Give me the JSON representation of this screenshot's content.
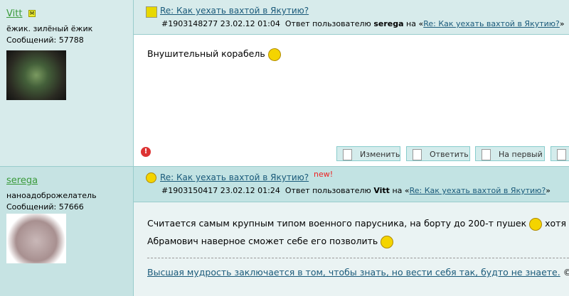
{
  "posts": [
    {
      "author": "Vitt",
      "moderator_badge": "М",
      "status": "ёжик. зилёный ёжик",
      "count": "Сообщений: 57788",
      "title": "Re: Как уехать вахтой в Якутию?",
      "id_date": "#1903148277 23.02.12 01:04",
      "reply_prefix": "Ответ пользователю",
      "reply_user": "serega",
      "reply_on": "на «",
      "reply_link": "Re: Как уехать вахтой в Якутию?",
      "reply_close": "»",
      "text": "Внушительный корабель",
      "icon": "book-icon",
      "buttons": [
        "Изменить",
        "Ответить",
        "На первый"
      ]
    },
    {
      "author": "serega",
      "status": "наноадоброжелатель",
      "count": "Сообщений: 57666",
      "title": "Re: Как уехать вахтой в Якутию?",
      "new_badge": "new!",
      "id_date": "#1903150417 23.02.12 01:24",
      "reply_prefix": "Ответ пользователю",
      "reply_user": "Vitt",
      "reply_on": "на «",
      "reply_link": "Re: Как уехать вахтой в Якутию?",
      "reply_close": "»",
      "text1": "Считается самым крупным типом военного парусника, на борту до 200-т пушек",
      "text2": "хотя",
      "text3": "Абрамович наверное сможет себе его позволить",
      "signature": "Высшая мудрость заключается в том, чтобы знать, но вести себя так, будто не знаете.",
      "signature_tail": "©",
      "icon": "smiley-icon"
    }
  ]
}
